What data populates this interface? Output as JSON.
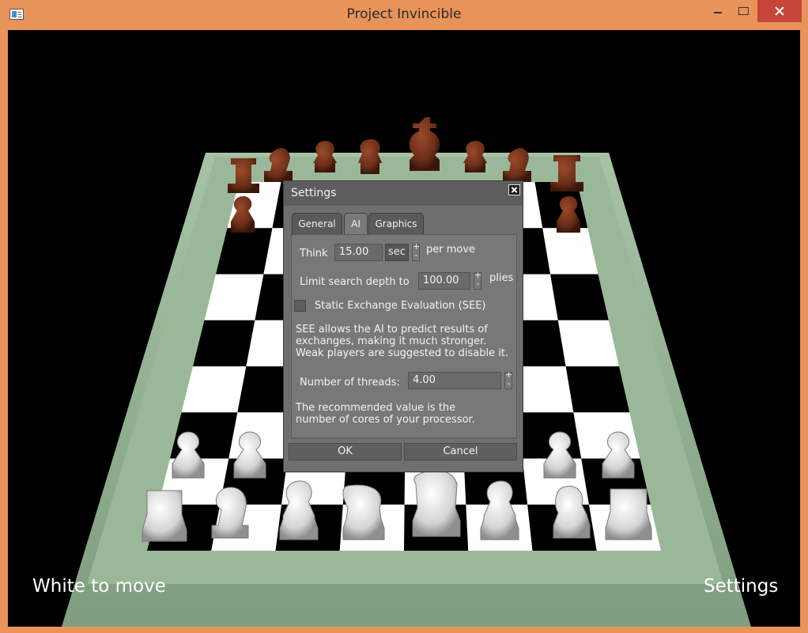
{
  "window": {
    "title": "Project Invincible"
  },
  "status": {
    "turn": "White to move",
    "settings_link": "Settings"
  },
  "dialog": {
    "title": "Settings",
    "tabs": [
      {
        "label": "General",
        "active": false
      },
      {
        "label": "AI",
        "active": true
      },
      {
        "label": "Graphics",
        "active": false
      }
    ],
    "think": {
      "label": "Think",
      "value": "15.00",
      "unit": "sec",
      "suffix": "per move"
    },
    "depth": {
      "label": "Limit search depth to",
      "value": "100.00",
      "suffix": "plies"
    },
    "see": {
      "label": "Static Exchange Evaluation (SEE)",
      "checked": false,
      "description": [
        "SEE allows the AI to predict results of",
        "exchanges, making it much stronger.",
        "Weak players are suggested to disable it."
      ]
    },
    "threads": {
      "label": "Number of threads:",
      "value": "4.00",
      "note": [
        "The recommended value is the",
        "number of cores of your processor."
      ]
    },
    "buttons": {
      "ok": "OK",
      "cancel": "Cancel"
    }
  },
  "colors": {
    "titlebar": "#e8935a",
    "close_button": "#c7443a",
    "board_frame": "#8fae90",
    "light_square": "#ffffff",
    "dark_square": "#000000",
    "dialog_bg": "#6f6f6f",
    "black_pieces": "#6b2e18",
    "white_pieces": "#e2e2e2"
  }
}
